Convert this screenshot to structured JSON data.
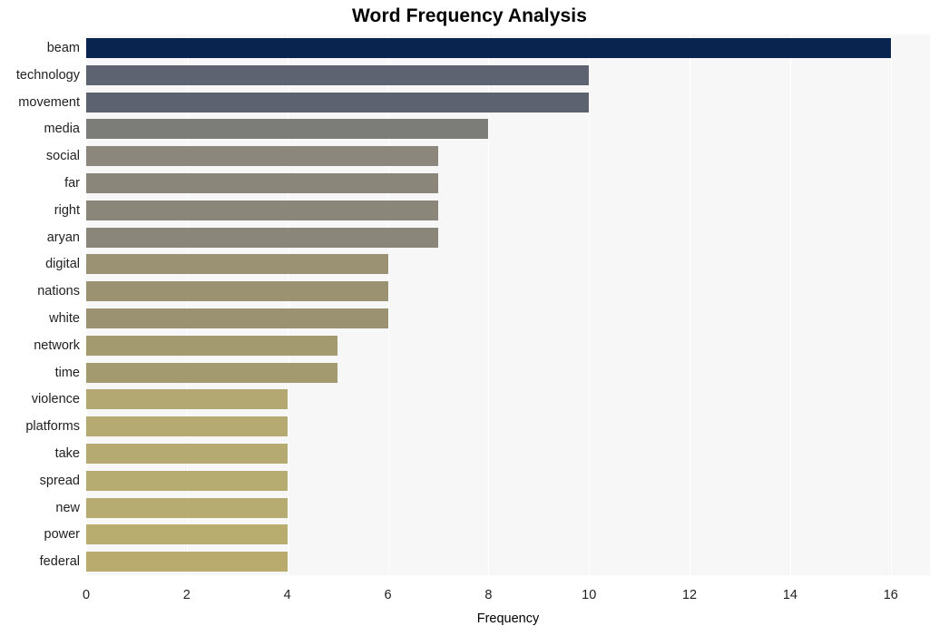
{
  "chart_data": {
    "type": "bar",
    "orientation": "horizontal",
    "title": "Word Frequency Analysis",
    "xlabel": "Frequency",
    "ylabel": "",
    "categories": [
      "beam",
      "technology",
      "movement",
      "media",
      "social",
      "far",
      "right",
      "aryan",
      "digital",
      "nations",
      "white",
      "network",
      "time",
      "violence",
      "platforms",
      "take",
      "spread",
      "new",
      "power",
      "federal"
    ],
    "values": [
      16,
      10,
      10,
      8,
      7,
      7,
      7,
      7,
      6,
      6,
      6,
      5,
      5,
      4,
      4,
      4,
      4,
      4,
      4,
      4
    ],
    "bar_colors": [
      "#0a2450",
      "#5e6372",
      "#5d6270",
      "#7c7c79",
      "#8b877c",
      "#8a867a",
      "#8a867a",
      "#8a867a",
      "#9a9272",
      "#9a9271",
      "#9a9270",
      "#a39a6f",
      "#a39a6f",
      "#b3a871",
      "#b5aa71",
      "#b5aa71",
      "#b6ab70",
      "#b6ab70",
      "#b8ac6f",
      "#b9ab6e"
    ],
    "xlim": [
      0,
      16.78
    ],
    "xticks": [
      0,
      2,
      4,
      6,
      8,
      10,
      12,
      14,
      16
    ],
    "xtick_labels": [
      "0",
      "2",
      "4",
      "6",
      "8",
      "10",
      "12",
      "14",
      "16"
    ],
    "grid": true,
    "grid_color": "#ffffff",
    "plot_background": "#f7f7f7",
    "figure_background": "#ffffff",
    "legend": null,
    "annotations": []
  }
}
